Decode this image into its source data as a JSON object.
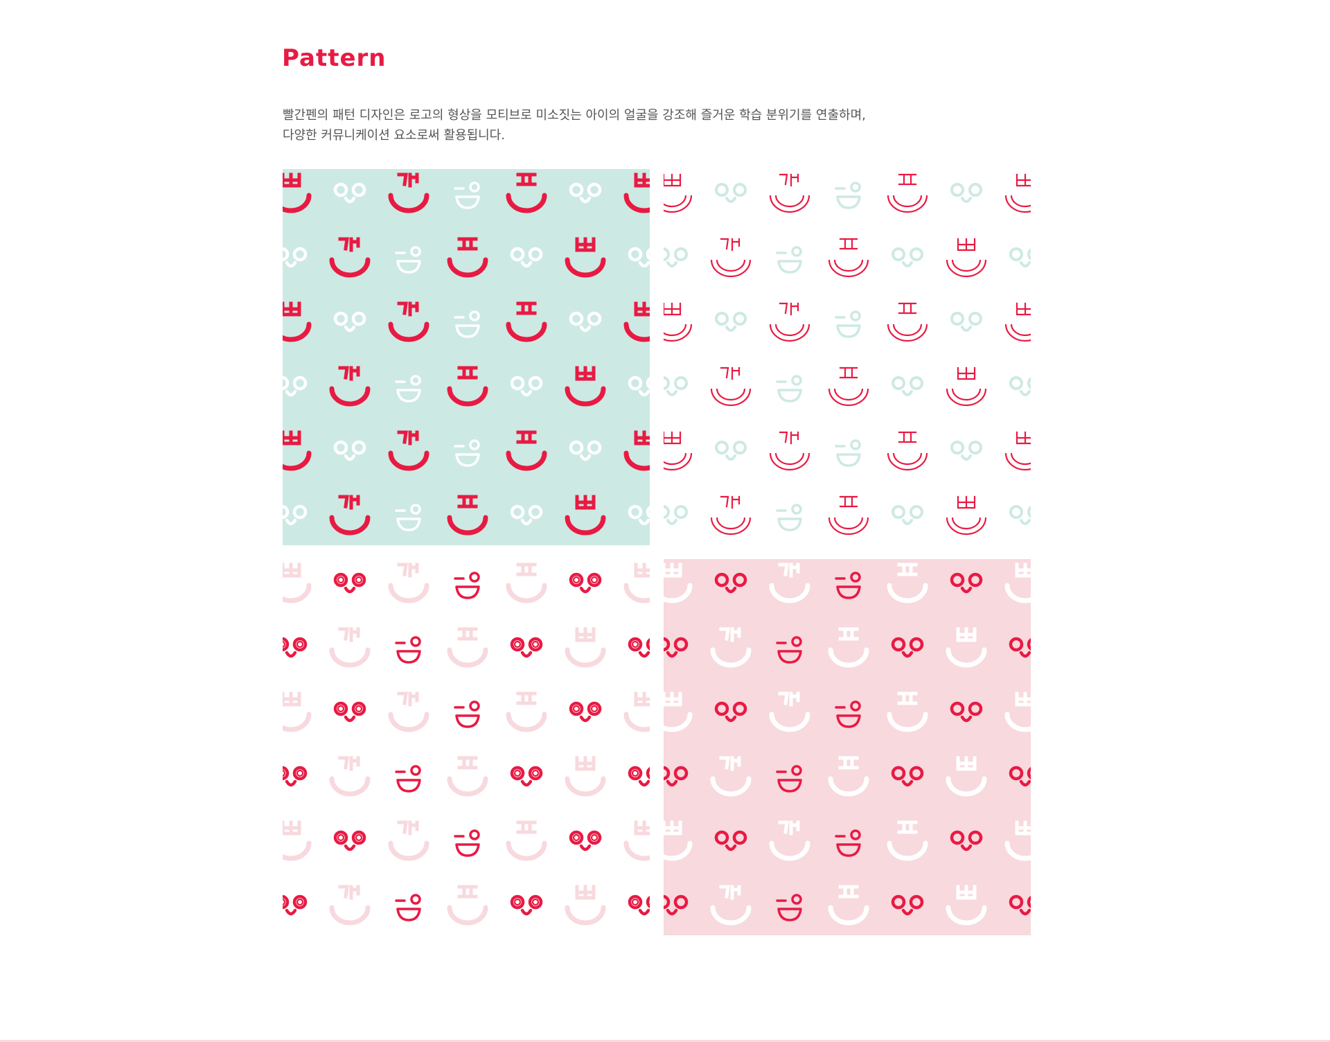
{
  "section": {
    "title": "Pattern",
    "description_lines": [
      "빨간펜의 패턴 디자인은 로고의 형상을 모티브로 미소짓는 아이의 얼굴을 강조해 즐거운 학습 분위기를 연출하며,",
      "다양한 커뮤니케이션 요소로써 활용됩니다."
    ]
  },
  "colors": {
    "brand_red": "#e81a43",
    "mint": "#cde9e3",
    "pink": "#f7d9de",
    "white": "#ffffff"
  },
  "pattern": {
    "face_sequence": [
      "ㅃ",
      "eyes",
      "가",
      "wink",
      "ㅍ",
      "eyes"
    ],
    "panels": [
      {
        "name": "mint-background-solid-faces",
        "background": "#cde9e3",
        "ink": "#e81a43",
        "alt": "#ffffff",
        "style": "solid"
      },
      {
        "name": "white-background-outline-faces",
        "background": "#ffffff",
        "ink": "#e81a43",
        "alt": "#cde9e3",
        "style": "outline"
      },
      {
        "name": "white-background-pink-faces",
        "background": "#ffffff",
        "ink": "#f7d9de",
        "alt": "#e81a43",
        "style": "double"
      },
      {
        "name": "pink-background-solid-faces",
        "background": "#f7d9de",
        "ink": "#ffffff",
        "alt": "#e81a43",
        "style": "solid"
      }
    ]
  }
}
